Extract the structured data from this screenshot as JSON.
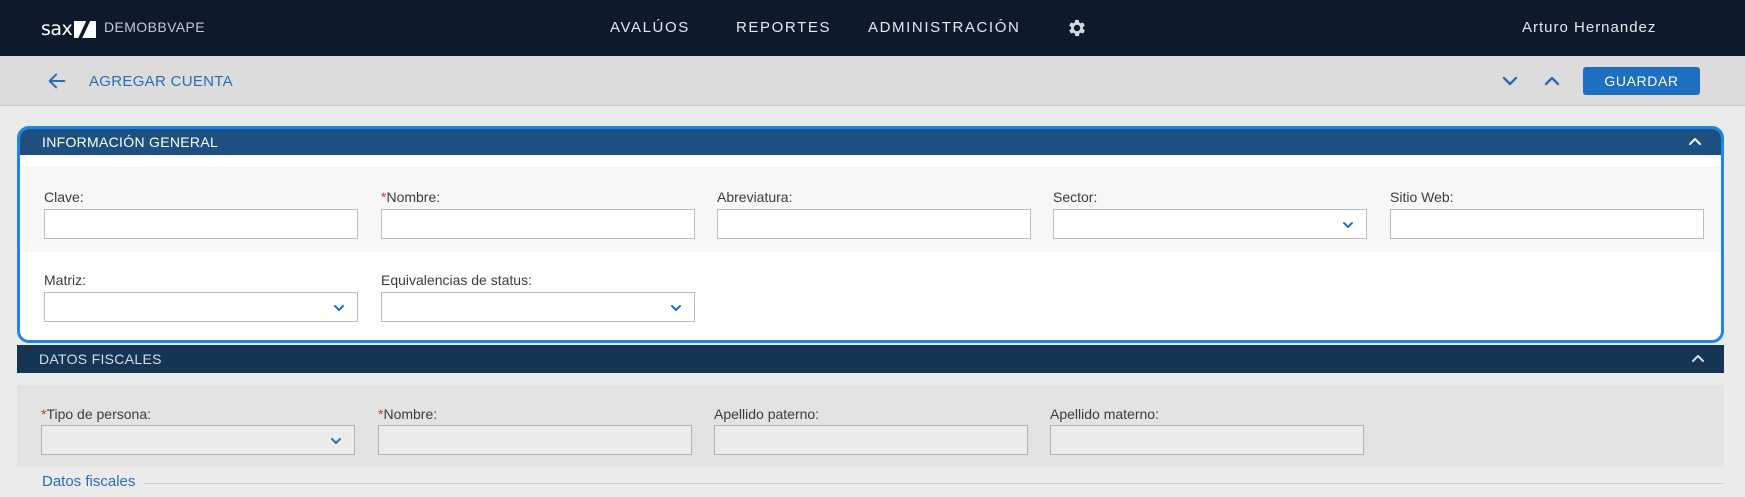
{
  "topbar": {
    "logo_text": "sax",
    "org_name": "DEMOBBVAPE",
    "nav": [
      "AVALÚOS",
      "REPORTES",
      "ADMINISTRACIÓN"
    ],
    "settings_icon": "gear-icon",
    "user_name": "Arturo Hernandez"
  },
  "subbar": {
    "back_icon": "arrow-left-icon",
    "title": "AGREGAR CUENTA",
    "save_label": "GUARDAR"
  },
  "general": {
    "title": "INFORMACIÓN GENERAL",
    "fields": {
      "clave": {
        "label": "Clave:",
        "value": ""
      },
      "nombre": {
        "label": "Nombre:",
        "required_mark": "*",
        "value": ""
      },
      "abreviatura": {
        "label": "Abreviatura:",
        "value": ""
      },
      "sector": {
        "label": "Sector:",
        "value": ""
      },
      "sitio_web": {
        "label": "Sitio Web:",
        "value": ""
      },
      "matriz": {
        "label": "Matriz:",
        "value": ""
      },
      "equivalencias": {
        "label": "Equivalencias de status:",
        "value": ""
      }
    }
  },
  "fiscal": {
    "title": "DATOS FISCALES",
    "fields": {
      "tipo_persona": {
        "label": "Tipo de persona:",
        "required_mark": "*",
        "value": ""
      },
      "nombre": {
        "label": "Nombre:",
        "required_mark": "*",
        "value": ""
      },
      "apellido_paterno": {
        "label": "Apellido paterno:",
        "value": ""
      },
      "apellido_materno": {
        "label": "Apellido materno:",
        "value": ""
      }
    },
    "subsection_link": "Datos fiscales"
  },
  "colors": {
    "topbar": "#0c1a2b",
    "accent": "#1f6fc0",
    "section_header": "#1d4f80",
    "focus_ring": "#1d87e8",
    "required": "#d9342b"
  }
}
